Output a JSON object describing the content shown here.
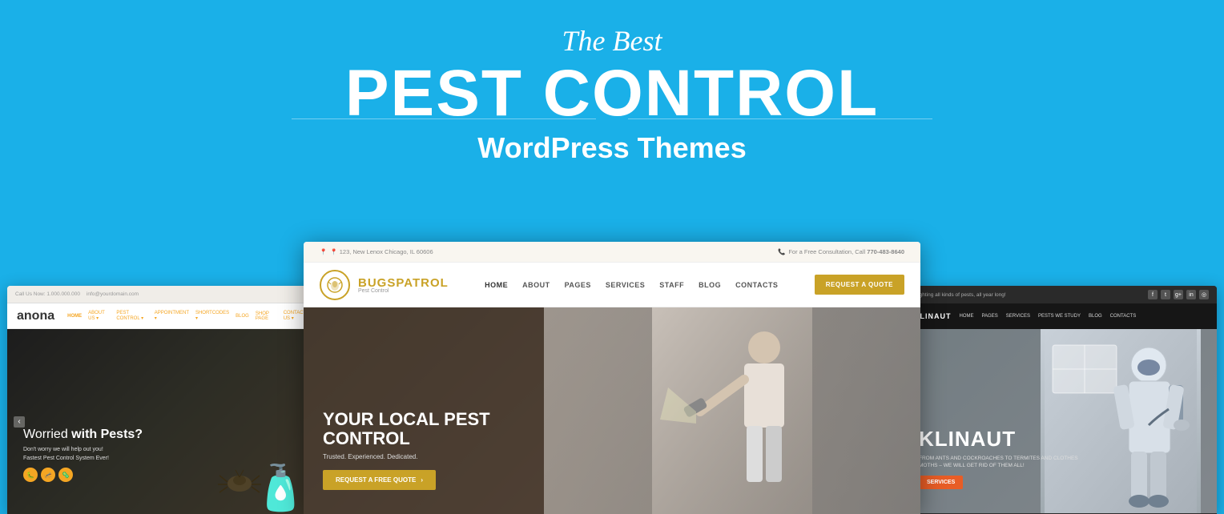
{
  "page": {
    "background_color": "#1ab0e8"
  },
  "header": {
    "subtitle": "The Best",
    "title": "PEST CONTROL",
    "wp_themes": "WordPress Themes"
  },
  "themes": {
    "left": {
      "name": "anona",
      "topbar": {
        "phone": "Call Us Now: 1.000.000.000",
        "email": "info@yourdomain.com"
      },
      "nav": {
        "logo": "anona",
        "items": [
          "Home",
          "About Us ▾",
          "Pest Control ▾",
          "Appointment ▾",
          "Shortcodes ▾",
          "Blog",
          "Shop page",
          "Contact Us ▾"
        ]
      },
      "hero": {
        "title_normal": "Worried ",
        "title_bold": "with Pests?",
        "subtitle": "Don't worry we will help out you!",
        "subtitle2": "Fastest Pest Control System Ever!",
        "icons": [
          "🐛",
          "🦟",
          "🦠"
        ]
      }
    },
    "center": {
      "name": "bugspatrol",
      "topbar": {
        "address": "📍 123, New Lenox Chicago, IL 60606",
        "phone": "📞 For a Free Consultation, Call 770-483-8640"
      },
      "nav": {
        "logo_text_1": "BUGS",
        "logo_text_2": "PATROL",
        "logo_sub": "Pest Control",
        "items": [
          "HOME",
          "ABOUT",
          "PAGES",
          "SERVICES",
          "STAFF",
          "BLOG",
          "CONTACTS"
        ],
        "cta_btn": "REQUEST A QUOTE"
      },
      "hero": {
        "title": "YOUR LOCAL PEST CONTROL",
        "subtitle": "Trusted. Experienced. Dedicated.",
        "cta_btn": "REQUEST A FREE QUOTE"
      }
    },
    "right": {
      "name": "klinaut",
      "topbar": {
        "fighting": "...fighting all kinds of pests, all year long!",
        "social_icons": [
          "f",
          "t",
          "g+",
          "in",
          "◎"
        ]
      },
      "nav": {
        "logo": "KLINAUT",
        "items": [
          "HOME",
          "PAGES",
          "SERVICES",
          "PESTS WE STUDY",
          "BLOG",
          "CONTACTS"
        ]
      },
      "hero": {
        "title": "KLINAUT",
        "subtitle": "FROM ANTS AND COCKROACHES TO TERMITES AND CLOTHES MOTHS – WE WILL GET RID OF THEM ALL!",
        "services_btn": "SERVICES"
      }
    }
  }
}
